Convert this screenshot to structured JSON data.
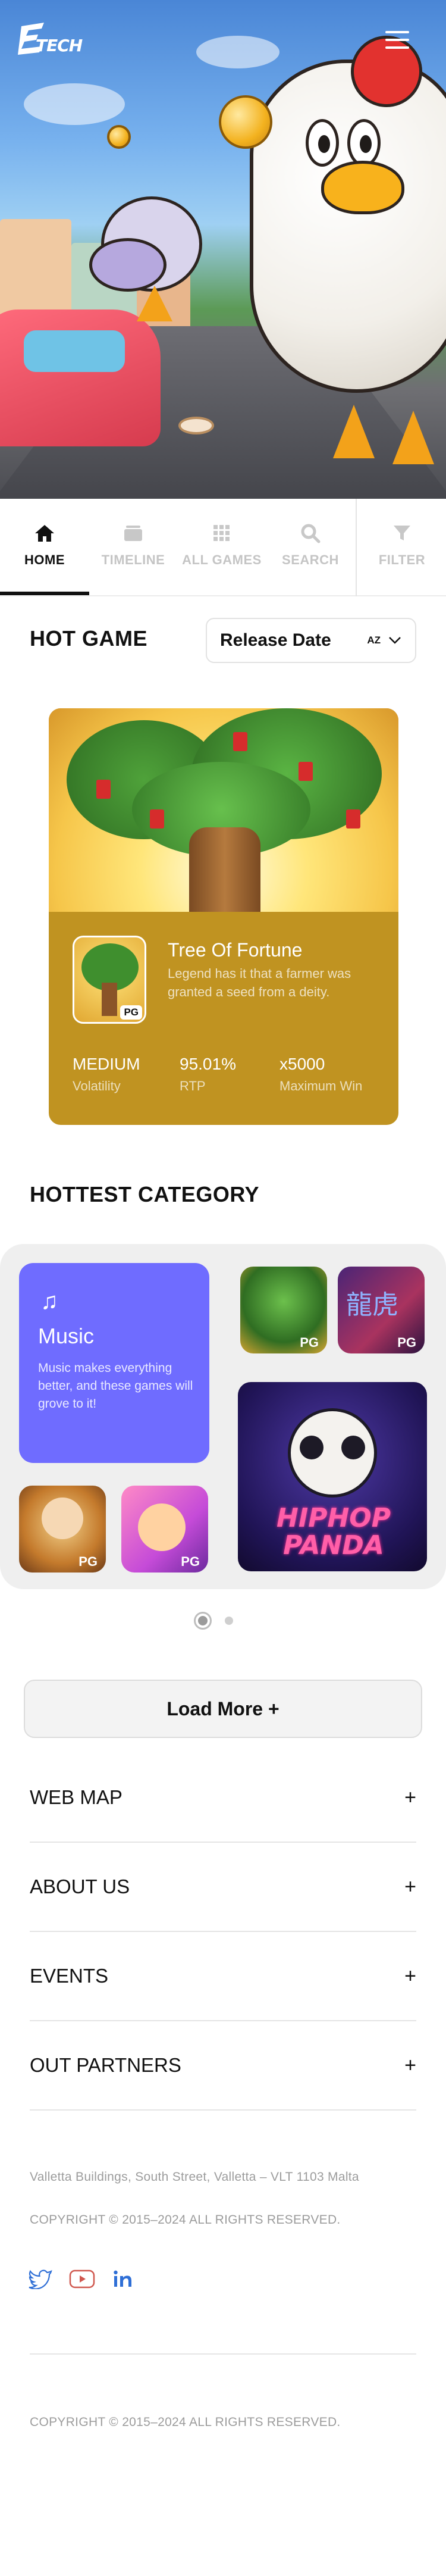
{
  "header": {
    "logo_text": "TECH",
    "menu_icon": "hamburger-menu-icon"
  },
  "tabs": [
    {
      "label": "HOME",
      "icon": "home-icon",
      "active": true
    },
    {
      "label": "TIMELINE",
      "icon": "timeline-icon",
      "active": false
    },
    {
      "label": "ALL GAMES",
      "icon": "grid-icon",
      "active": false
    },
    {
      "label": "SEARCH",
      "icon": "search-icon",
      "active": false
    },
    {
      "label": "FILTER",
      "icon": "filter-icon",
      "active": false
    }
  ],
  "hot_game": {
    "title": "HOT GAME",
    "sort": {
      "label": "Release Date",
      "az_label": "AZ",
      "icon": "chevron-down-icon"
    },
    "card": {
      "name": "Tree Of Fortune",
      "description": "Legend has it that a farmer was granted a seed from a deity.",
      "badge": "PG",
      "stats": [
        {
          "value": "MEDIUM",
          "label": "Volatility"
        },
        {
          "value": "95.01%",
          "label": "RTP"
        },
        {
          "value": "x5000",
          "label": "Maximum Win"
        }
      ]
    }
  },
  "hottest_category": {
    "title": "HOTTEST CATEGORY",
    "featured": {
      "title": "Music",
      "icon": "music-note-icon",
      "description": "Music makes everything better, and these games will grove to it!"
    },
    "tiles": [
      {
        "badge": "PG",
        "caption": ""
      },
      {
        "badge": "PG",
        "caption": "龍虎"
      },
      {
        "badge": "",
        "caption": "HIPHOP PANDA"
      },
      {
        "badge": "PG",
        "caption": ""
      },
      {
        "badge": "PG",
        "caption": ""
      }
    ],
    "pagination": {
      "pages": 2,
      "current": 1
    }
  },
  "load_more": {
    "label": "Load More +"
  },
  "accordion": [
    {
      "label": "WEB MAP",
      "symbol": "+"
    },
    {
      "label": "ABOUT US",
      "symbol": "+"
    },
    {
      "label": "EVENTS",
      "symbol": "+"
    },
    {
      "label": "OUT PARTNERS",
      "symbol": "+"
    }
  ],
  "footer": {
    "address": "Valletta Buildings, South Street, Valletta – VLT 1103 Malta",
    "copyright": "COPYRIGHT © 2015–2024 ALL RIGHTS RESERVED.",
    "social": [
      "twitter-icon",
      "youtube-icon",
      "linkedin-icon"
    ],
    "colors": {
      "social_accent": "#d0584f",
      "brand_blue": "#6f6cff"
    },
    "bottom_copyright": "COPYRIGHT © 2015–2024 ALL RIGHTS RESERVED."
  }
}
